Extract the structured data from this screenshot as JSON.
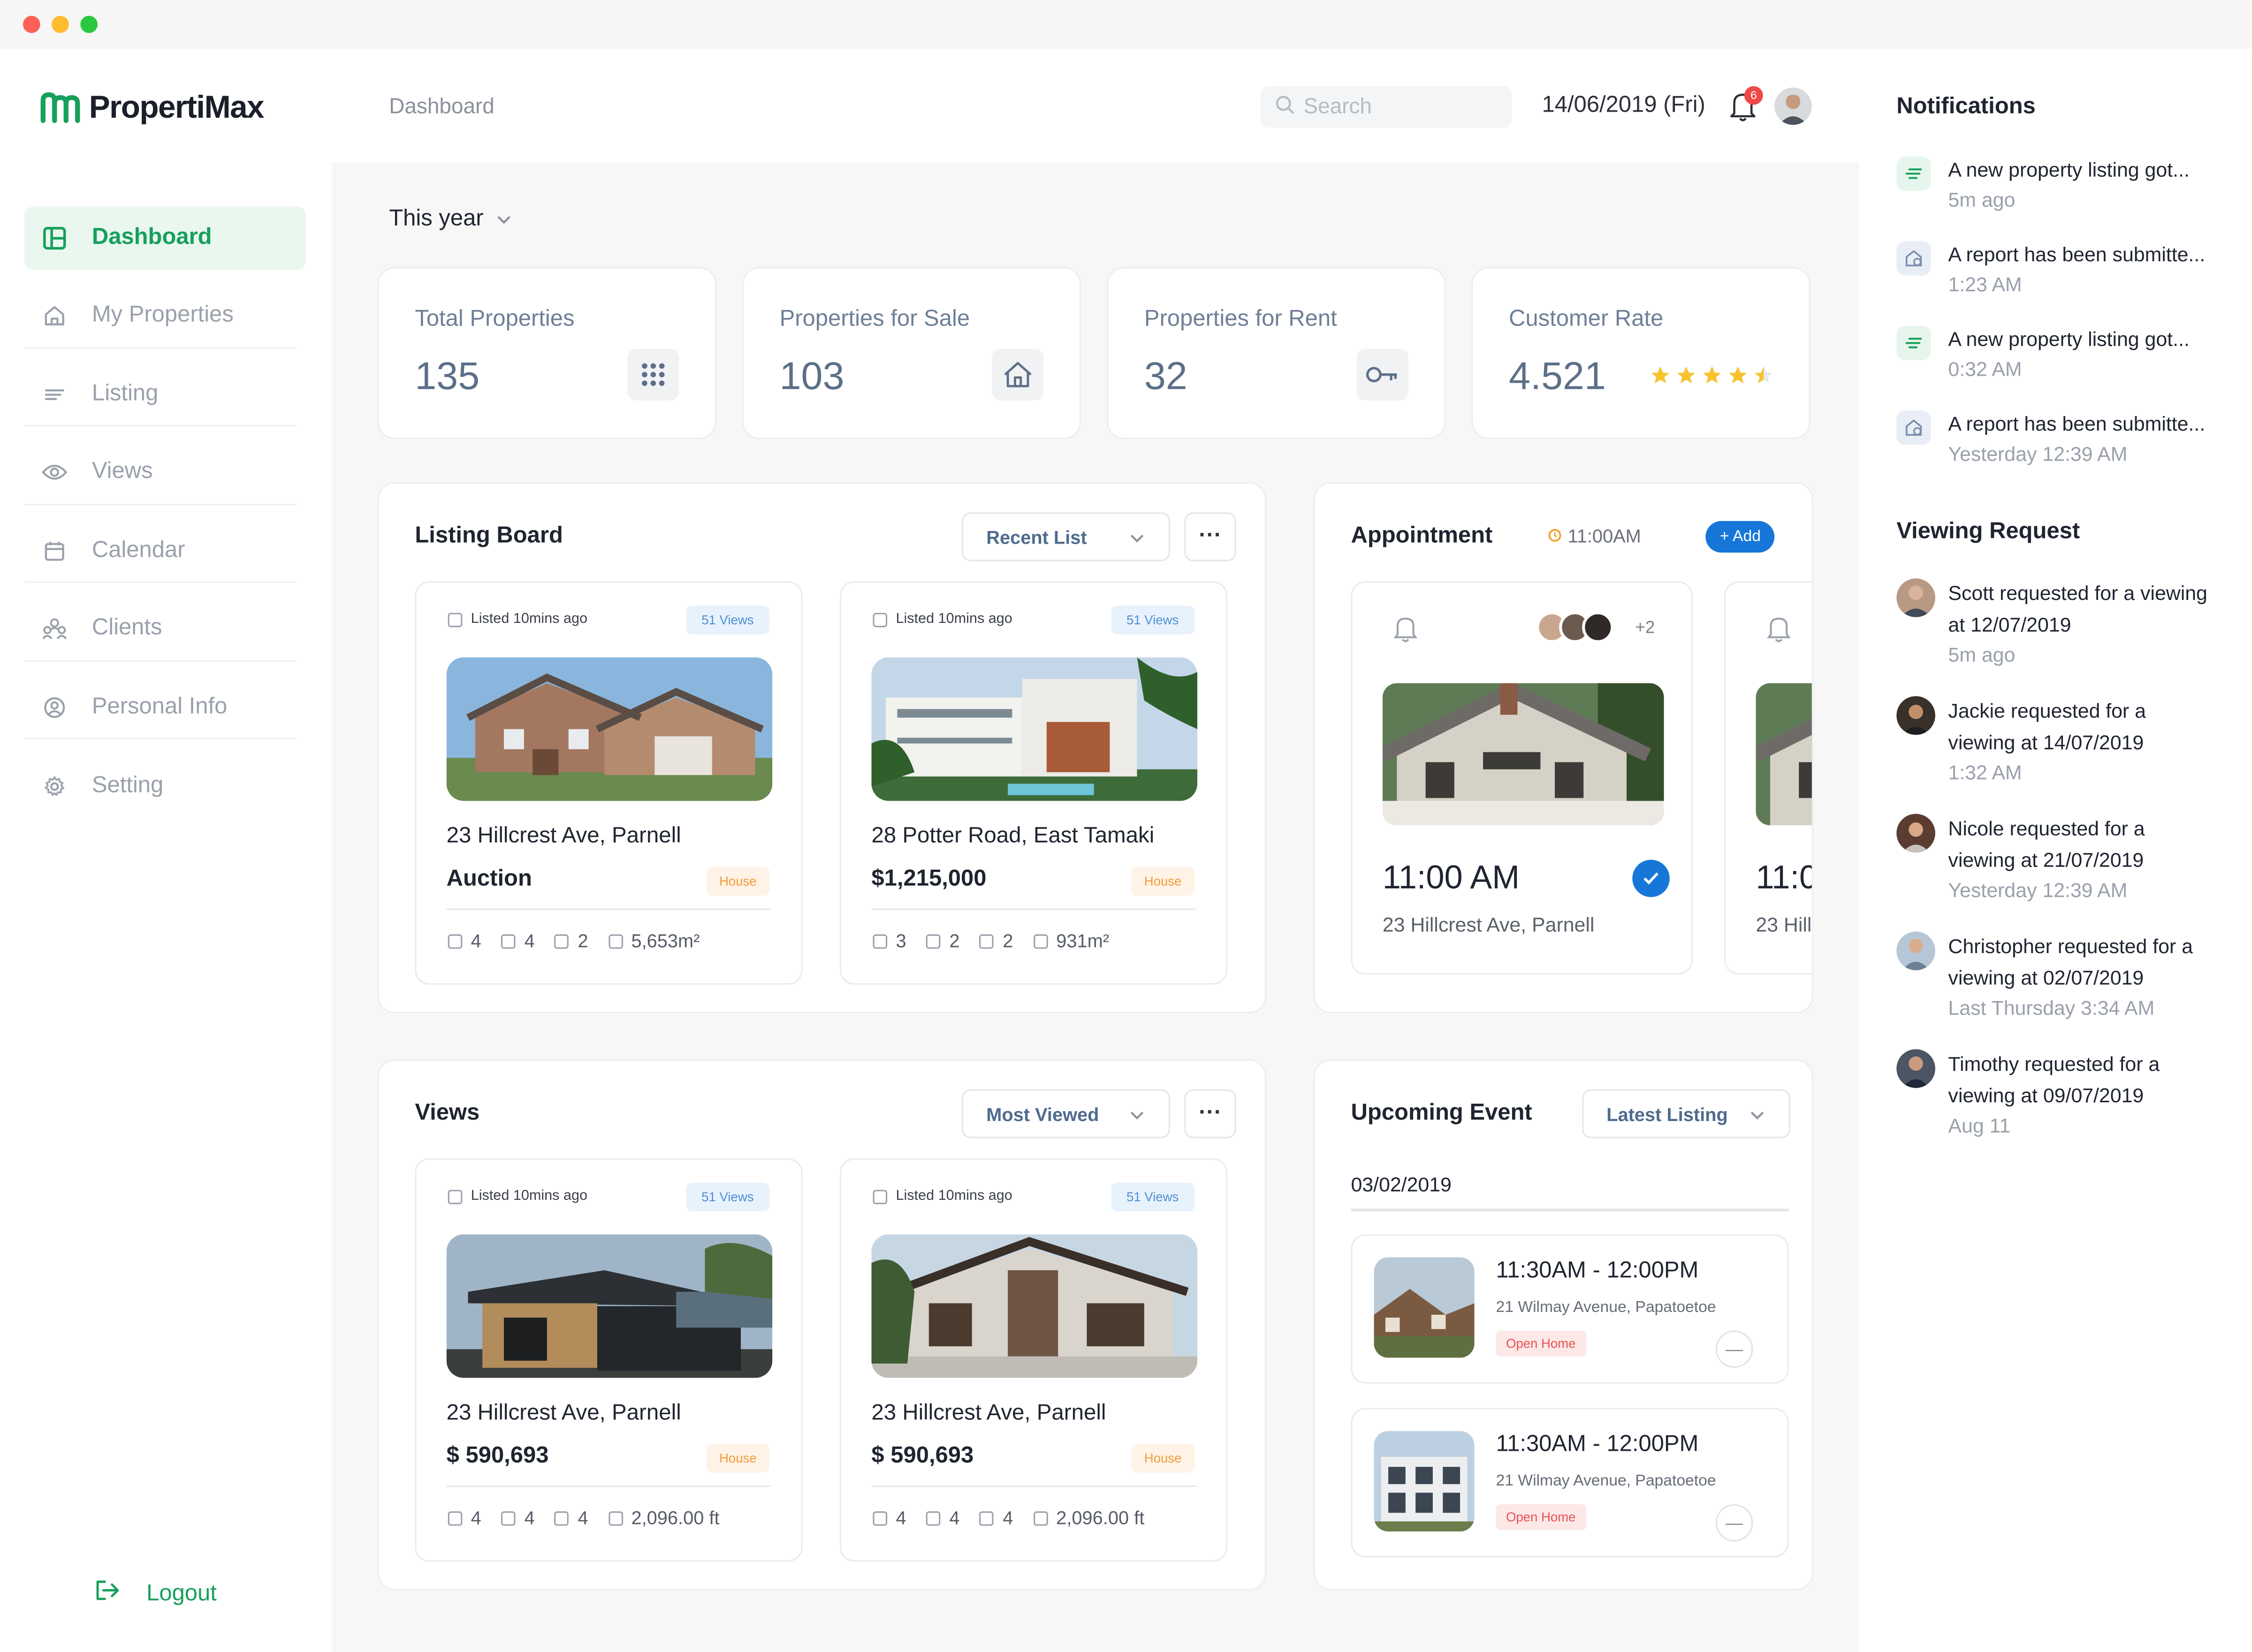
{
  "app": {
    "brand": "PropertiMax",
    "breadcrumb": "Dashboard"
  },
  "sidebar": {
    "items": [
      {
        "label": "Dashboard",
        "icon": "dashboard-icon",
        "active": true
      },
      {
        "label": "My Properties",
        "icon": "home-icon"
      },
      {
        "label": "Listing",
        "icon": "list-icon"
      },
      {
        "label": "Views",
        "icon": "eye-icon"
      },
      {
        "label": "Calendar",
        "icon": "calendar-icon"
      },
      {
        "label": "Clients",
        "icon": "clients-icon"
      },
      {
        "label": "Personal Info",
        "icon": "user-icon"
      },
      {
        "label": "Setting",
        "icon": "gear-icon"
      }
    ],
    "logout": "Logout"
  },
  "header": {
    "search_placeholder": "Search",
    "date": "14/06/2019 (Fri)",
    "notification_count": "6"
  },
  "filter": {
    "period": "This year"
  },
  "stats": [
    {
      "label": "Total Properties",
      "value": "135",
      "icon": "grid-icon"
    },
    {
      "label": "Properties for Sale",
      "value": "103",
      "icon": "house-icon"
    },
    {
      "label": "Properties for Rent",
      "value": "32",
      "icon": "key-icon"
    },
    {
      "label": "Customer Rate",
      "value": "4.521",
      "icon": "star-rating-icon",
      "rating": 4.5
    }
  ],
  "listing_board": {
    "title": "Listing Board",
    "dropdown": "Recent List",
    "cards": [
      {
        "listed": "Listed 10mins ago",
        "views": "51 Views",
        "address": "23 Hillcrest Ave, Parnell",
        "price": "Auction",
        "tag": "House",
        "beds": "4",
        "baths": "4",
        "cars": "2",
        "area": "5,653m²"
      },
      {
        "listed": "Listed 10mins ago",
        "views": "51 Views",
        "address": "28 Potter Road, East Tamaki",
        "price": "$1,215,000",
        "tag": "House",
        "beds": "3",
        "baths": "2",
        "cars": "2",
        "area": "931m²"
      }
    ]
  },
  "appointment": {
    "title": "Appointment",
    "time": "11:00AM",
    "add_label": "+ Add",
    "cards": [
      {
        "extra_attendees": "+2",
        "time": "11:00 AM",
        "address": "23 Hillcrest Ave, Parnell"
      },
      {
        "time": "11:0",
        "address": "23 Hill"
      }
    ]
  },
  "views": {
    "title": "Views",
    "dropdown": "Most Viewed",
    "cards": [
      {
        "listed": "Listed 10mins ago",
        "views": "51 Views",
        "address": "23 Hillcrest Ave, Parnell",
        "price": "$ 590,693",
        "tag": "House",
        "beds": "4",
        "baths": "4",
        "cars": "4",
        "area": "2,096.00 ft"
      },
      {
        "listed": "Listed 10mins ago",
        "views": "51 Views",
        "address": "23 Hillcrest Ave, Parnell",
        "price": "$ 590,693",
        "tag": "House",
        "beds": "4",
        "baths": "4",
        "cars": "4",
        "area": "2,096.00 ft"
      }
    ]
  },
  "upcoming": {
    "title": "Upcoming Event",
    "dropdown": "Latest Listing",
    "date": "03/02/2019",
    "events": [
      {
        "time": "11:30AM - 12:00PM",
        "address": "21 Wilmay Avenue, Papatoetoe",
        "tag": "Open Home"
      },
      {
        "time": "11:30AM - 12:00PM",
        "address": "21 Wilmay Avenue, Papatoetoe",
        "tag": "Open Home"
      }
    ]
  },
  "notifications": {
    "title": "Notifications",
    "items": [
      {
        "text": "A new property listing got...",
        "time": "5m ago",
        "kind": "listing"
      },
      {
        "text": "A report has been submitte...",
        "time": "1:23 AM",
        "kind": "report"
      },
      {
        "text": "A new property listing got...",
        "time": "0:32 AM",
        "kind": "listing"
      },
      {
        "text": "A report has been submitte...",
        "time": "Yesterday 12:39 AM",
        "kind": "report"
      }
    ]
  },
  "viewing_requests": {
    "title": "Viewing Request",
    "items": [
      {
        "line1": "Scott requested for a viewing",
        "line2": "at 12/07/2019",
        "time": "5m ago"
      },
      {
        "line1": "Jackie requested for a",
        "line2": "viewing at 14/07/2019",
        "time": "1:32 AM"
      },
      {
        "line1": "Nicole requested for a",
        "line2": "viewing at 21/07/2019",
        "time": "Yesterday 12:39 AM"
      },
      {
        "line1": "Christopher requested for a",
        "line2": "viewing at 02/07/2019",
        "time": "Last Thursday 3:34 AM"
      },
      {
        "line1": "Timothy requested for a",
        "line2": "viewing at 09/07/2019",
        "time": "Aug 11"
      }
    ]
  },
  "colors": {
    "brand": "#16a05a",
    "accent_blue": "#1677d8",
    "house_tag": "#f39b3b",
    "open_home_tag": "#e85050"
  }
}
